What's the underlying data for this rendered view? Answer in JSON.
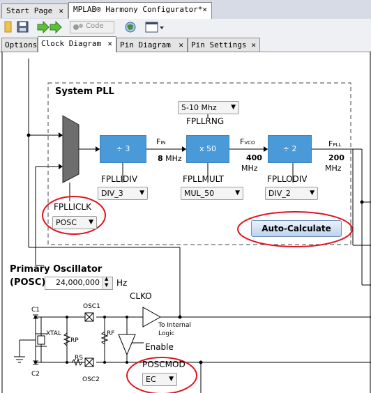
{
  "editor_tabs": [
    {
      "label": "Start Page"
    },
    {
      "label": "MPLAB® Harmony Configurator*"
    }
  ],
  "toolbar": {
    "code_label": "Code"
  },
  "sub_tabs": [
    {
      "label": "Options"
    },
    {
      "label": "Clock Diagram"
    },
    {
      "label": "Pin Diagram"
    },
    {
      "label": "Pin Settings"
    }
  ],
  "pll": {
    "title": "System PLL",
    "divider_block": "÷ 3",
    "mult_block": "x 50",
    "odiv_block": "÷ 2",
    "fin_main": "F",
    "fin_sub": "IN",
    "fin_value": "8",
    "fin_unit": "MHz",
    "fvco_main": "F",
    "fvco_sub": "VCO",
    "fvco_value": "400",
    "fvco_unit": "MHz",
    "fpll_main": "F",
    "fpll_sub": "PLL",
    "fpll_value": "200",
    "fpll_unit": "MHz",
    "range_value": "5-10 Mhz",
    "range_label": "FPLLRNG",
    "idiv_label": "FPLLIDIV",
    "idiv_value": "DIV_3",
    "mult_label": "FPLLMULT",
    "mult_value": "MUL_50",
    "odiv_label": "FPLLODIV",
    "odiv_value": "DIV_2",
    "iclk_label": "FPLLICLK",
    "iclk_value": "POSC",
    "auto_calc_label": "Auto-Calculate"
  },
  "osc": {
    "title_line1": "Primary Oscillator",
    "title_line2": "(POSC)",
    "freq_value": "24,000,000",
    "freq_unit": "Hz",
    "clko_label": "CLKO",
    "c1": "C1",
    "c2": "C2",
    "xtal": "XTAL",
    "rp": "RP",
    "rf": "RF",
    "rs": "RS",
    "osc1": "OSC1",
    "osc2": "OSC2",
    "to_internal": "To Internal",
    "logic": "Logic",
    "enable": "Enable",
    "mod_label": "POSCMOD",
    "mod_value": "EC"
  },
  "colors": {
    "block_blue": "#4a9ad9",
    "highlight_red": "#e0141e"
  }
}
